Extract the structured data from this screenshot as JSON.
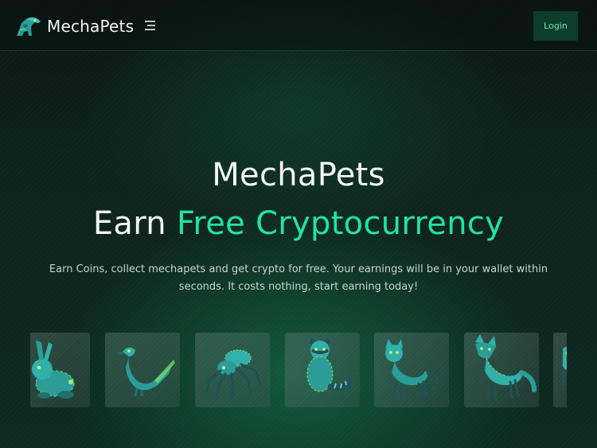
{
  "navbar": {
    "brand_name": "MechaPets",
    "logo_icon": "mechapet-dino-logo-icon",
    "menu_icon": "hamburger-menu-icon",
    "login_label": "Login"
  },
  "hero": {
    "title": "MechaPets",
    "subtitle_prefix": "Earn",
    "subtitle_accent": "Free Cryptocurrency",
    "description": "Earn Coins, collect mechapets and get crypto for free. Your earnings will be in your wallet within seconds. It costs nothing, start earning today!"
  },
  "pets": [
    {
      "icon": "robot-rabbit-icon"
    },
    {
      "icon": "robot-bird-icon"
    },
    {
      "icon": "robot-spider-icon"
    },
    {
      "icon": "robot-raccoon-icon"
    },
    {
      "icon": "robot-cat-icon"
    },
    {
      "icon": "robot-fox-icon"
    },
    {
      "icon": "robot-pet-partial-icon"
    }
  ],
  "colors": {
    "accent": "#22e3a6",
    "background": "#0c1c17",
    "login_bg": "#0c3d2d",
    "login_text": "#6fe7b8",
    "mecha_teal": "#2aa3a0",
    "mecha_green": "#7be36a"
  }
}
